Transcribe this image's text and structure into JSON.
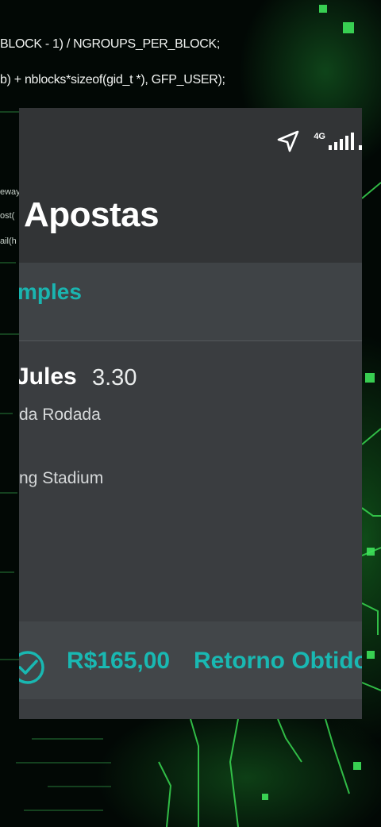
{
  "background": {
    "code_line_1": "BLOCK - 1) / NGROUPS_PER_BLOCK;",
    "code_line_2": "b) + nblocks*sizeof(gid_t *), GFP_USER);",
    "side_1": "eway",
    "side_2": "ost(",
    "side_3": "ail(h",
    "accent_color": "#2fd14a"
  },
  "status_bar": {
    "network": "4G",
    "icons": [
      "navigation-arrow-icon",
      "signal-icon"
    ]
  },
  "app_bar": {
    "title": "Apostas"
  },
  "tab": {
    "label": "mples"
  },
  "bet": {
    "match": "Jules",
    "odds": "3.30",
    "round": "da Rodada",
    "venue": "ng Stadium"
  },
  "footer": {
    "amount": "R$165,00",
    "status": "Retorno Obtido",
    "icon": "check-circle-icon",
    "accent_color": "#19b8b2"
  }
}
